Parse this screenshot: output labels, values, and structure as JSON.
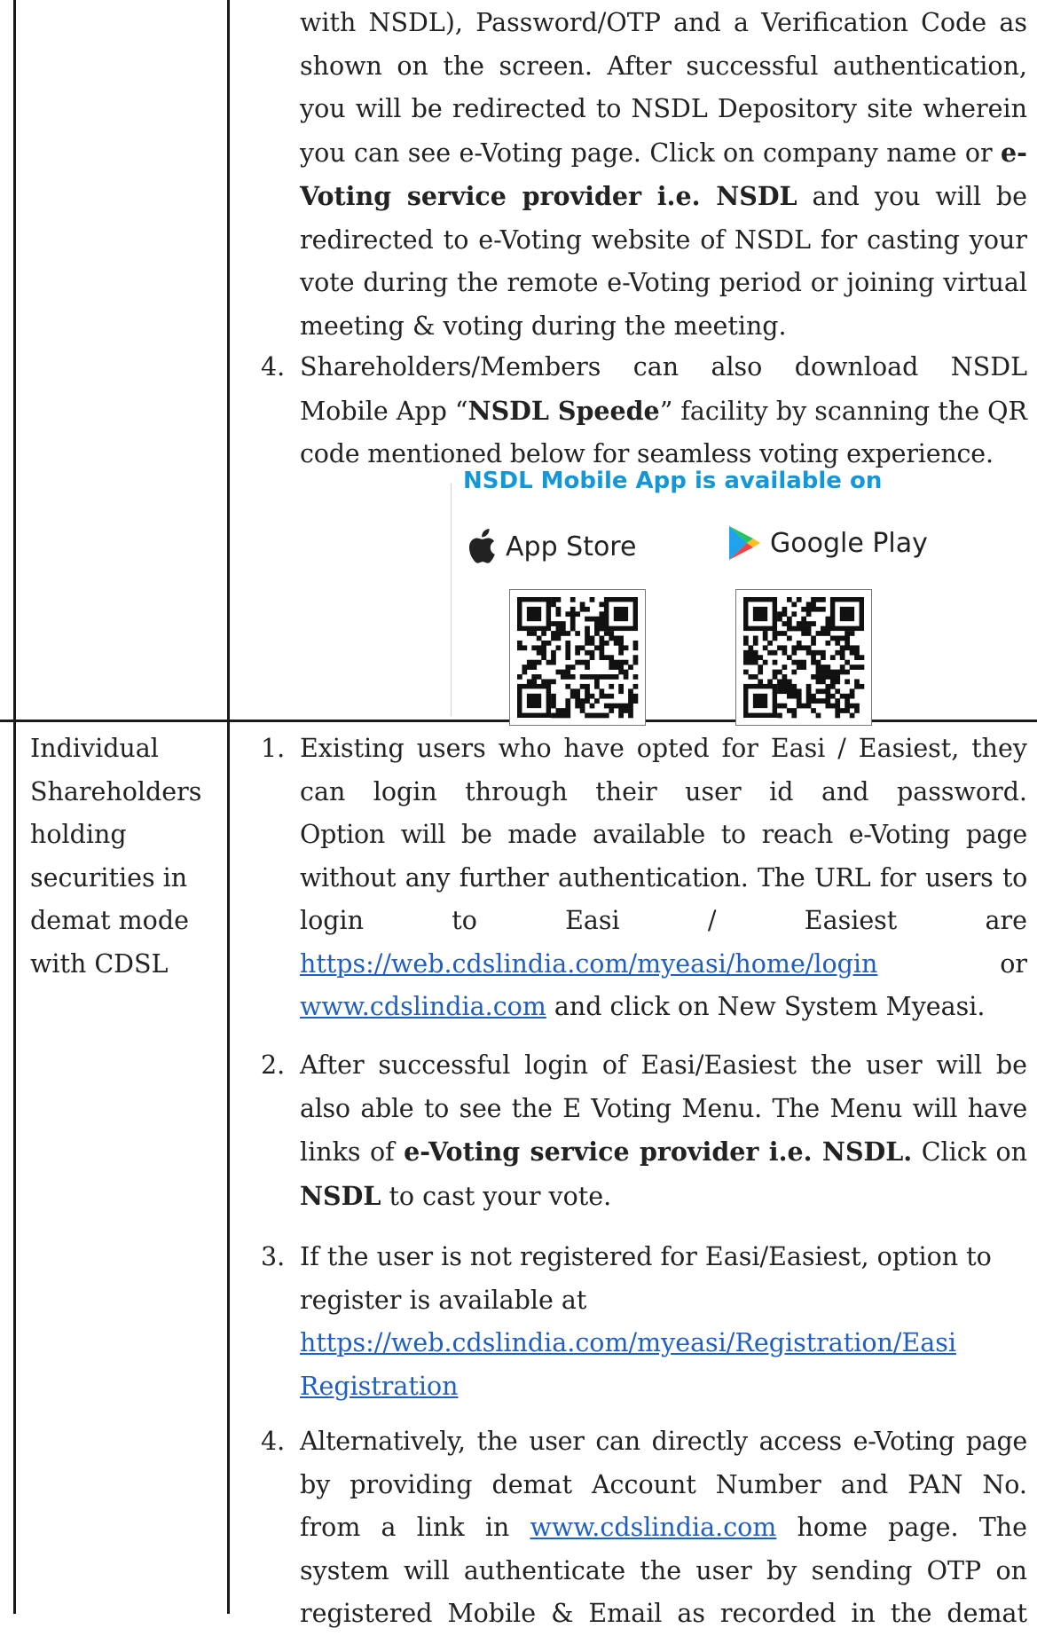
{
  "top_item": {
    "continuation_lines": [
      "with NSDL), Password/OTP and a Verification Code as",
      "shown on the screen. After successful authentication,",
      "you will be redirected to NSDL Depository site wherein",
      "you can see e-Voting page. Click on company name or"
    ],
    "bold_fragment_1": "e-",
    "bold_fragment_2": "Voting service provider i.e. NSDL",
    "line5_tail": "and you will be",
    "lines_after": [
      "redirected to e-Voting website of NSDL for casting your",
      "vote during the remote e-Voting period or joining virtual",
      "meeting & voting during the meeting."
    ]
  },
  "item4_top": {
    "number": "4.",
    "line1": "Shareholders/Members can also download NSDL",
    "line2_a": "Mobile App “",
    "line2_bold": "NSDL Speede",
    "line2_b": "” facility by scanning the QR",
    "line3": "code mentioned below for seamless voting experience."
  },
  "app_box": {
    "title": "NSDL Mobile App is available on",
    "app_store": "App Store",
    "google_play": "Google Play"
  },
  "cdsl_row": {
    "left_label_lines": [
      "Individual",
      "Shareholders",
      "holding",
      "securities in",
      "demat mode",
      "with CDSL"
    ],
    "item1": {
      "number": "1.",
      "line1": "Existing users who have opted for Easi / Easiest, they",
      "line2": "can login through their user id and password.",
      "line3": "Option will be made available to reach e-Voting page",
      "line4": "without any further authentication. The URL for users to",
      "line5_words": [
        "login",
        "to",
        "Easi",
        "/",
        "Easiest",
        "are"
      ],
      "link1": "https://web.cdslindia.com/myeasi/home/login",
      "or": "or",
      "link2": "www.cdslindia.com",
      "line7_tail": "and click on New System Myeasi."
    },
    "item2": {
      "number": "2.",
      "line1": "After successful login of Easi/Easiest the user will be",
      "line2": "also able to see the E Voting Menu. The Menu will have",
      "line3_a": "links of ",
      "line3_bold": "e-Voting service provider i.e. NSDL.",
      "line3_b": " Click on",
      "line4_bold": "NSDL",
      "line4_tail": " to cast your vote."
    },
    "item3": {
      "number": "3.",
      "line1": "If the user is not registered for Easi/Easiest, option to",
      "line2": "register is available at",
      "link_line1": "https://web.cdslindia.com/myeasi/Registration/Easi",
      "link_line2": "Registration"
    },
    "item4": {
      "number": "4.",
      "line1": "Alternatively, the user can directly access e-Voting page",
      "line2": "by providing demat Account Number and PAN No.",
      "line3_a": "from a link in ",
      "line3_link": "www.cdslindia.com",
      "line3_b": " home page. The",
      "line4": "system will authenticate the user by sending OTP on",
      "line5": "registered Mobile & Email as recorded in the demat"
    }
  }
}
